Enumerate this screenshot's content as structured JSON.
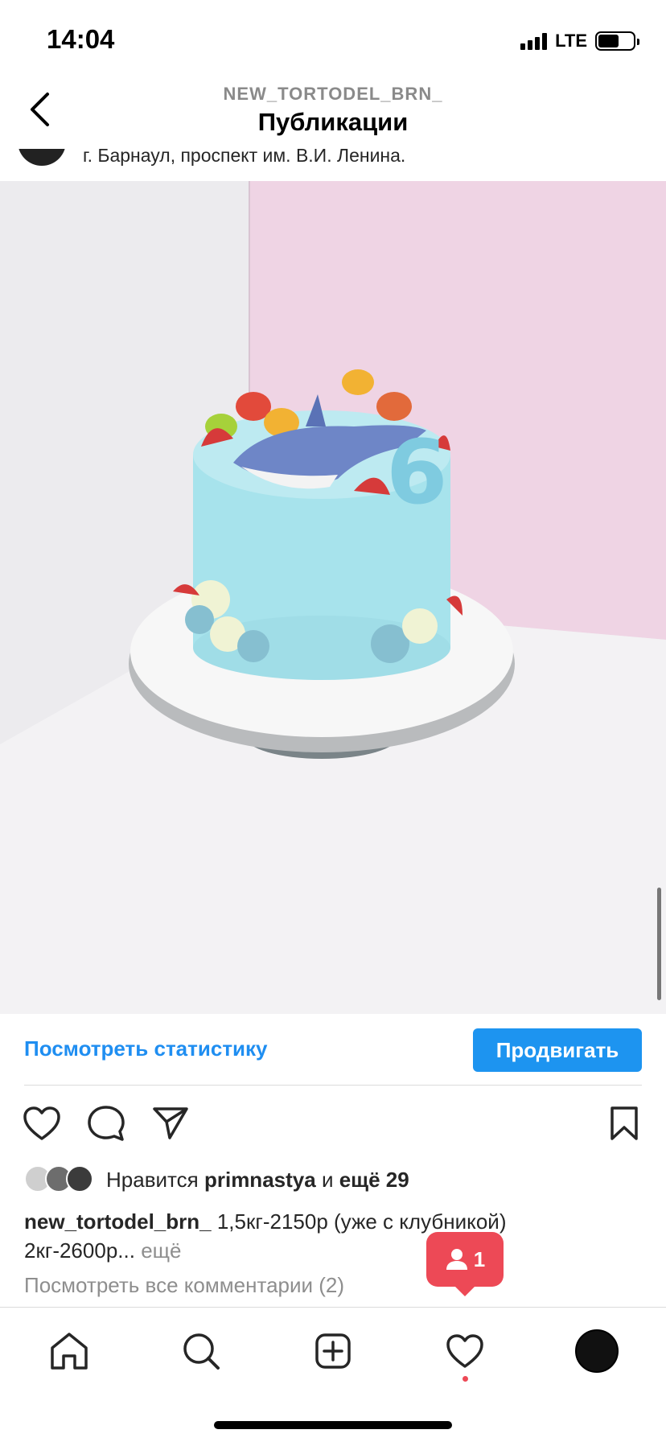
{
  "status_bar": {
    "time": "14:04",
    "network": "LTE",
    "battery_level": 0.6
  },
  "header": {
    "account": "NEW_TORTODEL_BRN_",
    "title": "Публикации"
  },
  "post": {
    "location": "г. Барнаул, проспект им. В.И. Ленина.",
    "photo_number_label": "6",
    "insights": {
      "stats_link": "Посмотреть статистику",
      "promote_button": "Продвигать"
    },
    "likes": {
      "prefix": "Нравится",
      "user": "primnastya",
      "joiner": "и",
      "others": "ещё 29"
    },
    "caption": {
      "username": "new_tortodel_brn_",
      "line1": "1,5кг-2150р (уже с клубникой)",
      "line2": "2кг-2600р...",
      "more": "ещё"
    },
    "comments_link": "Посмотреть все комментарии (2)"
  },
  "notification": {
    "count": "1"
  },
  "colors": {
    "accent": "#1d94f0",
    "badge": "#ed4956",
    "link": "#1f8ef1"
  }
}
